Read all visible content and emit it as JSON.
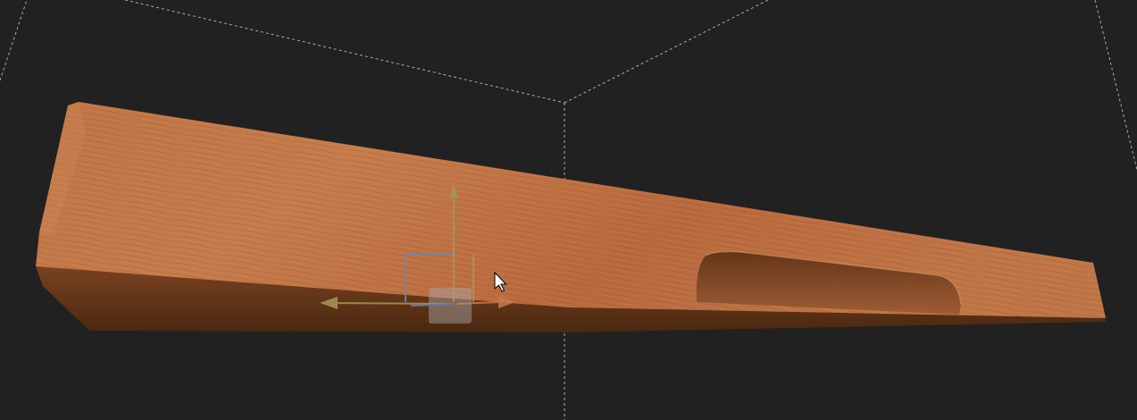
{
  "app": {
    "view_label": ""
  },
  "scene": {
    "object": "wooden-plank",
    "tool": "move-gizmo",
    "colors": {
      "background": "#212121",
      "grid_line": "#c9c9c9",
      "wood_light": "#c77a48",
      "wood_mid": "#b5693a",
      "wood_dark": "#6e3a1e",
      "gizmo_x": "#c87850",
      "gizmo_y": "#a09a55",
      "gizmo_z": "#6a86b8"
    },
    "icons": [
      "cursor-arrow-icon",
      "move-gizmo-icon"
    ]
  }
}
